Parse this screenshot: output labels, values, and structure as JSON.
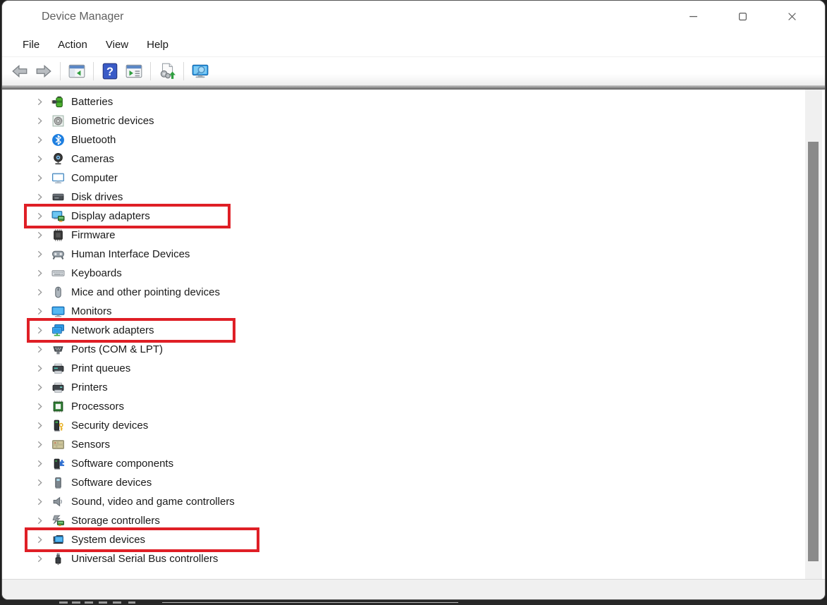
{
  "window": {
    "title": "Device Manager",
    "app_icon": "device-manager-icon",
    "controls": [
      {
        "icon": "minimize-icon"
      },
      {
        "icon": "maximize-icon"
      },
      {
        "icon": "close-icon"
      }
    ]
  },
  "menu": {
    "items": [
      "File",
      "Action",
      "View",
      "Help"
    ]
  },
  "toolbar": {
    "buttons": [
      {
        "icon": "back-arrow-icon"
      },
      {
        "icon": "forward-arrow-icon"
      },
      {
        "icon": "console-tree-icon"
      },
      {
        "icon": "help-icon"
      },
      {
        "icon": "properties-window-icon"
      },
      {
        "icon": "scan-hardware-icon"
      },
      {
        "icon": "search-computer-icon"
      }
    ]
  },
  "tree": {
    "items": [
      {
        "label": "Batteries",
        "icon": "batteries-icon",
        "highlighted": false
      },
      {
        "label": "Biometric devices",
        "icon": "biometric-icon",
        "highlighted": false
      },
      {
        "label": "Bluetooth",
        "icon": "bluetooth-icon",
        "highlighted": false
      },
      {
        "label": "Cameras",
        "icon": "camera-icon",
        "highlighted": false
      },
      {
        "label": "Computer",
        "icon": "computer-icon",
        "highlighted": false
      },
      {
        "label": "Disk drives",
        "icon": "disk-drive-icon",
        "highlighted": false
      },
      {
        "label": "Display adapters",
        "icon": "display-adapter-icon",
        "highlighted": true
      },
      {
        "label": "Firmware",
        "icon": "firmware-icon",
        "highlighted": false
      },
      {
        "label": "Human Interface Devices",
        "icon": "hid-icon",
        "highlighted": false
      },
      {
        "label": "Keyboards",
        "icon": "keyboard-icon",
        "highlighted": false
      },
      {
        "label": "Mice and other pointing devices",
        "icon": "mouse-icon",
        "highlighted": false
      },
      {
        "label": "Monitors",
        "icon": "monitor-icon",
        "highlighted": false
      },
      {
        "label": "Network adapters",
        "icon": "network-adapter-icon",
        "highlighted": true
      },
      {
        "label": "Ports (COM & LPT)",
        "icon": "ports-icon",
        "highlighted": false
      },
      {
        "label": "Print queues",
        "icon": "print-queue-icon",
        "highlighted": false
      },
      {
        "label": "Printers",
        "icon": "printer-icon",
        "highlighted": false
      },
      {
        "label": "Processors",
        "icon": "processor-icon",
        "highlighted": false
      },
      {
        "label": "Security devices",
        "icon": "security-device-icon",
        "highlighted": false
      },
      {
        "label": "Sensors",
        "icon": "sensor-icon",
        "highlighted": false
      },
      {
        "label": "Software components",
        "icon": "software-component-icon",
        "highlighted": false
      },
      {
        "label": "Software devices",
        "icon": "software-device-icon",
        "highlighted": false
      },
      {
        "label": "Sound, video and game controllers",
        "icon": "sound-icon",
        "highlighted": false
      },
      {
        "label": "Storage controllers",
        "icon": "storage-controller-icon",
        "highlighted": false
      },
      {
        "label": "System devices",
        "icon": "system-device-icon",
        "highlighted": true
      },
      {
        "label": "Universal Serial Bus controllers",
        "icon": "usb-icon",
        "highlighted": false
      }
    ]
  },
  "annotations": {
    "highlight_color": "#df1f26",
    "highlighted_items": [
      "Display adapters",
      "Network adapters",
      "System devices"
    ]
  },
  "status_bar": {
    "text": ""
  }
}
